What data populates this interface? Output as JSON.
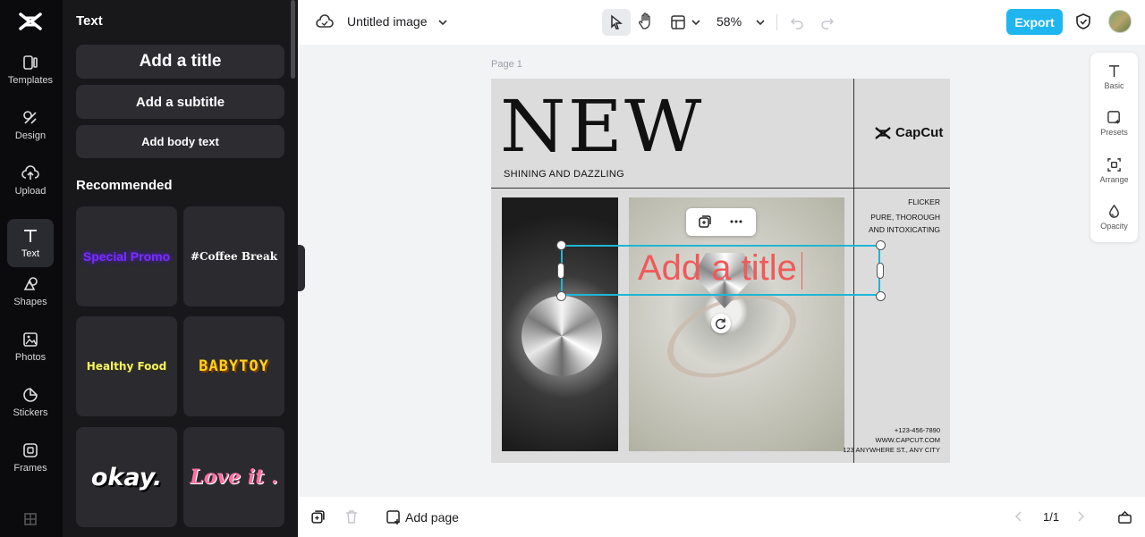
{
  "panel": {
    "title": "Text",
    "buttons": [
      "Add a title",
      "Add a subtitle",
      "Add body text"
    ],
    "recommended_title": "Recommended",
    "presets": [
      "Special Promo",
      "#Coffee Break",
      "Healthy Food",
      "BABYTOY",
      "okay.",
      "Love it ."
    ]
  },
  "rail": {
    "items": [
      "Templates",
      "Design",
      "Upload",
      "Text",
      "Shapes",
      "Photos",
      "Stickers",
      "Frames"
    ],
    "active": "Text"
  },
  "topbar": {
    "doc_title": "Untitled image",
    "zoom": "58%",
    "export_label": "Export"
  },
  "canvas": {
    "page_label": "Page 1",
    "headline": "NEW",
    "subline": "SHINING AND DAZZLING",
    "brand": "CapCut",
    "side_1": "FLICKER",
    "side_2a": "PURE, THOROUGH",
    "side_2b": "AND INTOXICATING",
    "contact_1": "+123-456-7890",
    "contact_2": "WWW.CAPCUT.COM",
    "contact_3": "123 ANYWHERE ST., ANY CITY",
    "selected_text": "Add a title"
  },
  "right_tools": [
    "Basic",
    "Presets",
    "Arrange",
    "Opacity"
  ],
  "bottombar": {
    "add_page": "Add page",
    "pager": "1/1"
  },
  "colors": {
    "accent": "#1fb6f0",
    "selection": "#1fb6d6",
    "title_text": "#ef5a5a"
  }
}
